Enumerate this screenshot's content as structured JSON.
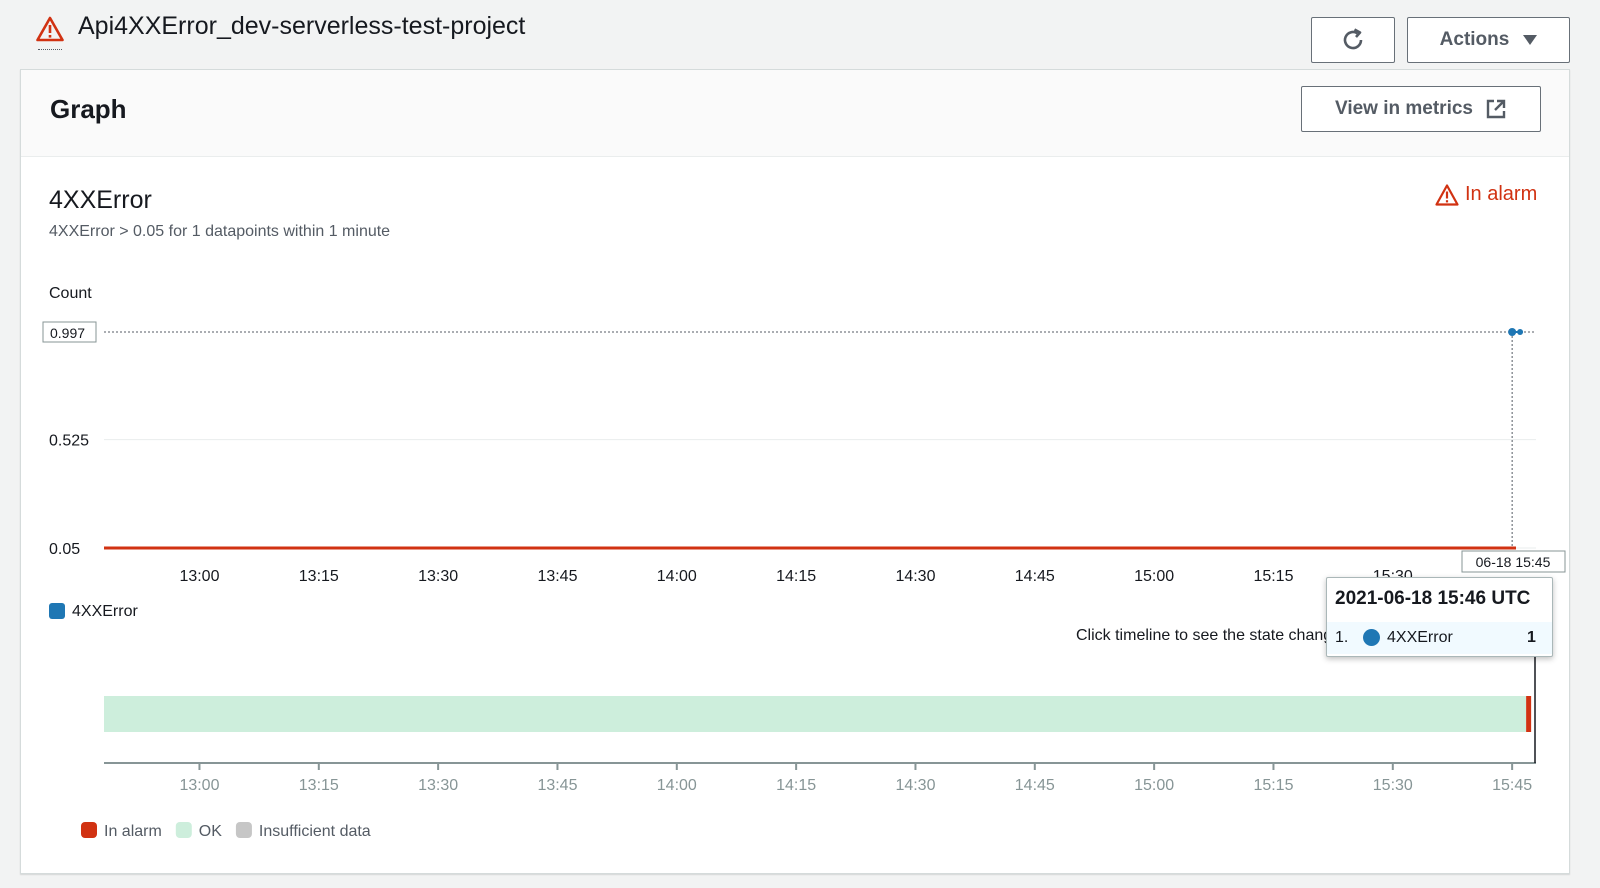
{
  "page": {
    "title": "Api4XXError_dev-serverless-test-project",
    "actions_label": "Actions",
    "refresh_icon": "refresh-icon",
    "warning_icon": "warning-icon"
  },
  "graph_panel": {
    "title": "Graph",
    "view_metrics_label": "View in metrics",
    "external_link_icon": "external-link-icon"
  },
  "alarm": {
    "metric_name": "4XXError",
    "condition": "4XXError > 0.05 for 1 datapoints within 1 minute",
    "state_label": "In alarm",
    "state_color": "#d13212"
  },
  "chart_data": {
    "type": "line",
    "ylabel": "Count",
    "y_ticks": [
      "0.997",
      "0.525",
      "0.05"
    ],
    "ylim": [
      0.05,
      0.997
    ],
    "threshold": 0.05,
    "threshold_color": "#d13212",
    "x_tick_labels": [
      "13:00",
      "13:15",
      "13:30",
      "13:45",
      "14:00",
      "14:15",
      "14:30",
      "14:45",
      "15:00",
      "15:15",
      "15:30",
      "15:45"
    ],
    "xlim": [
      "12:48",
      "15:48"
    ],
    "series": [
      {
        "name": "4XXError",
        "color": "#1f77b4",
        "points": [
          {
            "x": "15:45",
            "y": 0.997
          },
          {
            "x": "15:46",
            "y": 0.997
          }
        ]
      }
    ],
    "hover_x_label": "06-18 15:45",
    "legend": [
      "4XXError"
    ]
  },
  "tooltip": {
    "title": "2021-06-18 15:46 UTC",
    "index": "1.",
    "series": "4XXError",
    "value": "1"
  },
  "timeline": {
    "hint": "Click timeline to see the state change",
    "x_tick_labels": [
      "13:00",
      "13:15",
      "13:30",
      "13:45",
      "14:00",
      "14:15",
      "14:30",
      "14:45",
      "15:00",
      "15:15",
      "15:30",
      "15:45"
    ],
    "segments": [
      {
        "state": "OK",
        "start": "12:48",
        "end": "15:45"
      },
      {
        "state": "In alarm",
        "start": "15:45",
        "end": "15:46"
      }
    ],
    "legend": [
      {
        "label": "In alarm",
        "color": "#d13212"
      },
      {
        "label": "OK",
        "color": "#cdeedc"
      },
      {
        "label": "Insufficient data",
        "color": "#c6c6c6"
      }
    ]
  }
}
